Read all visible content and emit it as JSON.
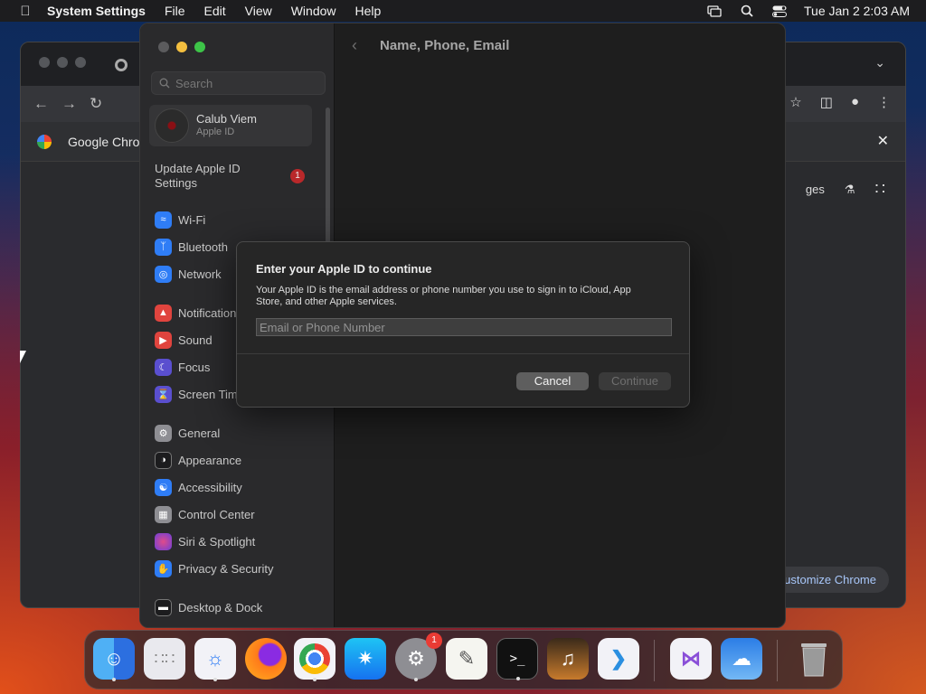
{
  "menubar": {
    "app": "System Settings",
    "items": [
      "File",
      "Edit",
      "View",
      "Window",
      "Help"
    ],
    "clock": "Tue Jan 2  2:03 AM"
  },
  "chrome": {
    "banner_title": "Google Chrome",
    "ntp_link_partial": "ges",
    "customize_label": "ustomize Chrome"
  },
  "settings": {
    "header_title": "Name, Phone, Email",
    "search_placeholder": "Search",
    "account": {
      "name": "Calub Viem",
      "subtitle": "Apple ID"
    },
    "update": {
      "label": "Update Apple ID Settings",
      "badge": "1"
    },
    "items": [
      {
        "label": "Wi-Fi",
        "icon": "wifi-icon",
        "color": "#2f7df6"
      },
      {
        "label": "Bluetooth",
        "icon": "bluetooth-icon",
        "color": "#2f7df6"
      },
      {
        "label": "Network",
        "icon": "globe-icon",
        "color": "#2f7df6"
      },
      {
        "label": "Notifications",
        "icon": "bell-icon",
        "color": "#e0443e"
      },
      {
        "label": "Sound",
        "icon": "speaker-icon",
        "color": "#e0443e"
      },
      {
        "label": "Focus",
        "icon": "moon-icon",
        "color": "#5a4fcf"
      },
      {
        "label": "Screen Time",
        "icon": "hourglass-icon",
        "color": "#5a4fcf"
      },
      {
        "label": "General",
        "icon": "gear-icon",
        "color": "#8e8e93"
      },
      {
        "label": "Appearance",
        "icon": "appearance-icon",
        "color": "#1c1c1e"
      },
      {
        "label": "Accessibility",
        "icon": "accessibility-icon",
        "color": "#2f7df6"
      },
      {
        "label": "Control Center",
        "icon": "control-center-icon",
        "color": "#8e8e93"
      },
      {
        "label": "Siri & Spotlight",
        "icon": "siri-icon",
        "color": "#b64bd8"
      },
      {
        "label": "Privacy & Security",
        "icon": "hand-icon",
        "color": "#2f7df6"
      },
      {
        "label": "Desktop & Dock",
        "icon": "dock-icon",
        "color": "#1c1c1e"
      }
    ]
  },
  "dialog": {
    "title": "Enter your Apple ID to continue",
    "text": "Your Apple ID is the email address or phone number you use to sign in to iCloud, App Store, and other Apple services.",
    "input_placeholder": "Email or Phone Number",
    "input_value": "",
    "cancel_label": "Cancel",
    "continue_label": "Continue"
  },
  "dock": {
    "apps": [
      {
        "name": "Finder",
        "icon": "finder-icon",
        "running": true
      },
      {
        "name": "Launchpad",
        "icon": "launchpad-icon",
        "running": false
      },
      {
        "name": "Safari",
        "icon": "safari-icon",
        "running": true
      },
      {
        "name": "Firefox",
        "icon": "firefox-icon",
        "running": false
      },
      {
        "name": "Google Chrome",
        "icon": "chrome-icon",
        "running": true
      },
      {
        "name": "App Store",
        "icon": "app-store-icon",
        "running": false
      },
      {
        "name": "System Settings",
        "icon": "settings-gear-icon",
        "running": true,
        "badge": "1"
      },
      {
        "name": "TextEdit",
        "icon": "textedit-icon",
        "running": false
      },
      {
        "name": "Terminal",
        "icon": "terminal-icon",
        "running": true
      },
      {
        "name": "GarageBand",
        "icon": "guitar-icon",
        "running": false
      },
      {
        "name": "Visual Studio Code",
        "icon": "vscode-icon",
        "running": false
      },
      {
        "name": "Visual Studio",
        "icon": "visual-studio-icon",
        "running": false
      },
      {
        "name": "Weather",
        "icon": "weather-icon",
        "running": false
      },
      {
        "name": "Trash",
        "icon": "trash-icon",
        "running": false
      }
    ]
  }
}
